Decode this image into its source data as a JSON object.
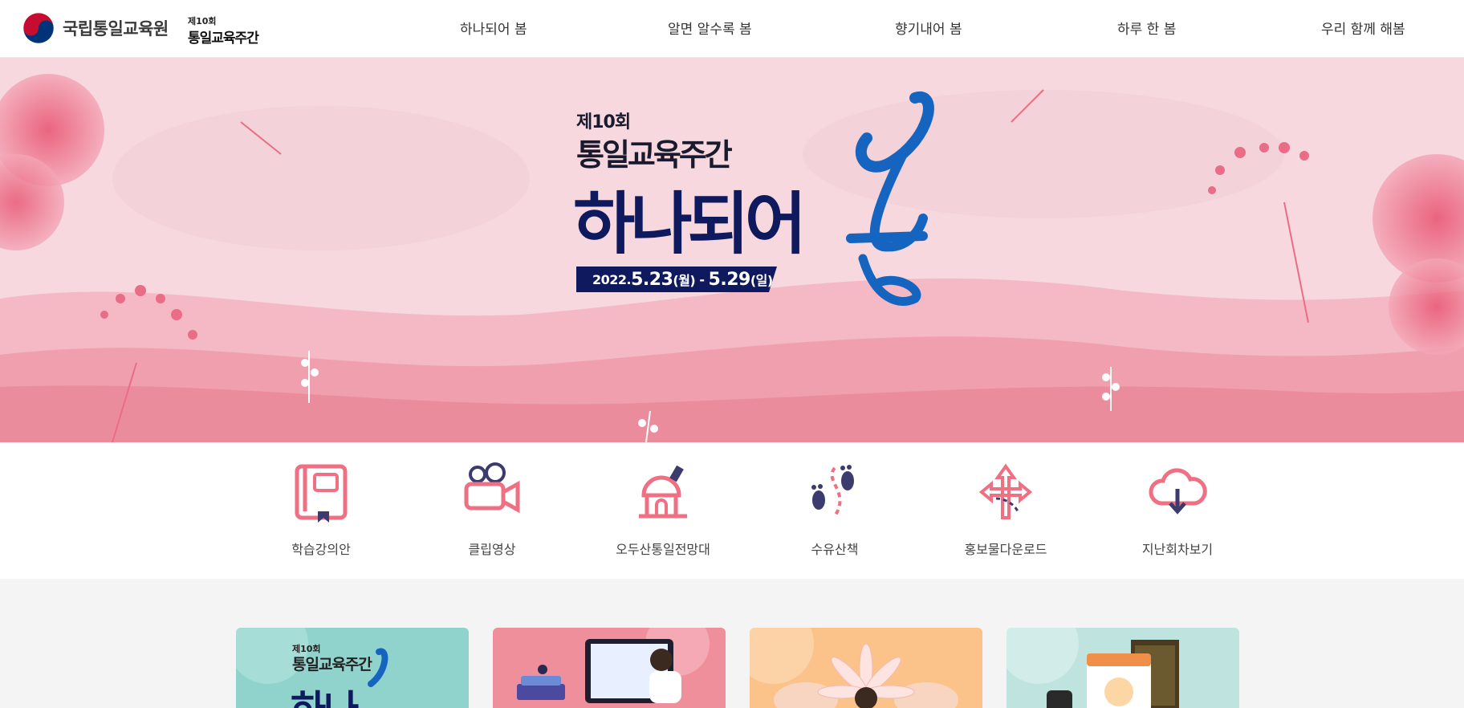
{
  "header": {
    "logo_text": "국립통일교육원",
    "sub_logo_small": "제10회",
    "sub_logo_big": "통일교육주간",
    "nav": [
      "하나되어 봄",
      "알면 알수록 봄",
      "향기내어 봄",
      "하루 한 봄",
      "우리 함께 해봄"
    ]
  },
  "hero": {
    "edition": "제10회",
    "week": "통일교육주간",
    "main": "하나되어",
    "main_accent": "봄",
    "date_year": "2022.",
    "date_start": "5.23",
    "date_start_day": "(월)",
    "date_sep": " - ",
    "date_end": "5.29",
    "date_end_day": "(일)",
    "colors": {
      "navy": "#0f1a5e",
      "blue": "#1565c0",
      "pink": "#f2a7b4"
    }
  },
  "quick_menu": [
    {
      "label": "학습강의안",
      "icon": "book-icon"
    },
    {
      "label": "클립영상",
      "icon": "video-camera-icon"
    },
    {
      "label": "오두산통일전망대",
      "icon": "observatory-icon"
    },
    {
      "label": "수유산책",
      "icon": "footprints-icon"
    },
    {
      "label": "홍보물다운로드",
      "icon": "directions-arrows-icon"
    },
    {
      "label": "지난회차보기",
      "icon": "cloud-download-icon"
    }
  ],
  "cards": [
    {
      "small": "제10회",
      "week": "통일교육주간",
      "big": "하나",
      "color": "#8fd3cc"
    },
    {
      "color": "#ef8f9c"
    },
    {
      "color": "#fbc38a"
    },
    {
      "color": "#bfe4e0"
    }
  ]
}
